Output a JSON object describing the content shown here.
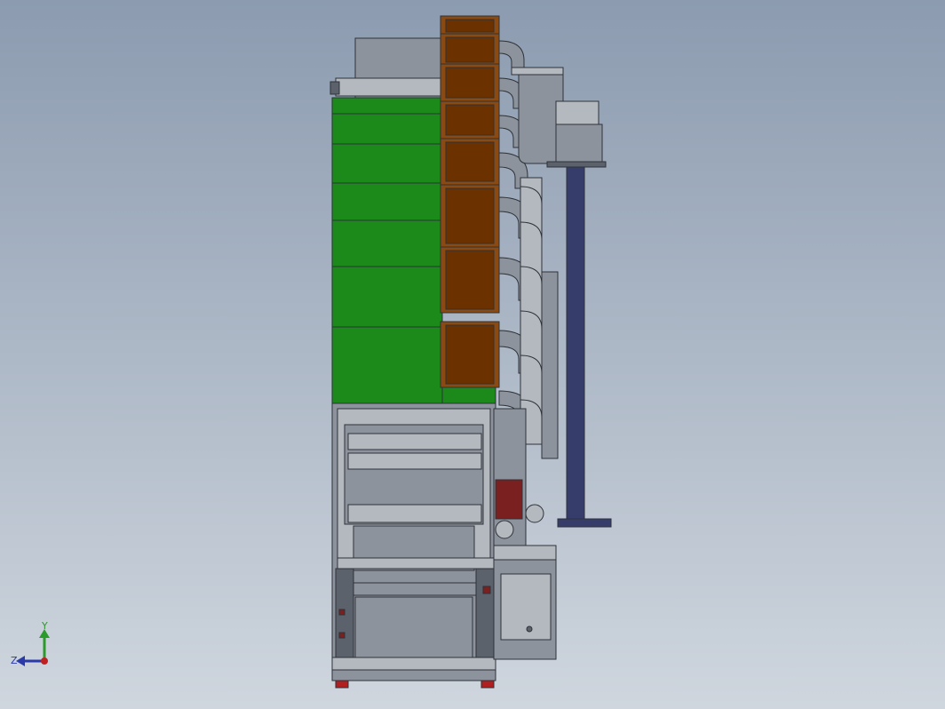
{
  "viewport": {
    "background_top": "#8c9bb0",
    "background_bottom": "#cfd6de"
  },
  "model": {
    "colors": {
      "dryer_panel": "#1b8a1b",
      "duct_box": "#6b3200",
      "duct_frame": "#8a4a12",
      "metal": "#8d939c",
      "metal_dark": "#5c626b",
      "metal_light": "#b4b9c0",
      "support_column": "#363d6b",
      "roller_red": "#7a2020",
      "foot_red": "#b02020",
      "outline": "#2e3238"
    }
  },
  "triad": {
    "y_label": "Y",
    "z_label": "Z",
    "y_color": "#2a9a2a",
    "z_color": "#2a3aa8",
    "x_color": "#c02020"
  }
}
